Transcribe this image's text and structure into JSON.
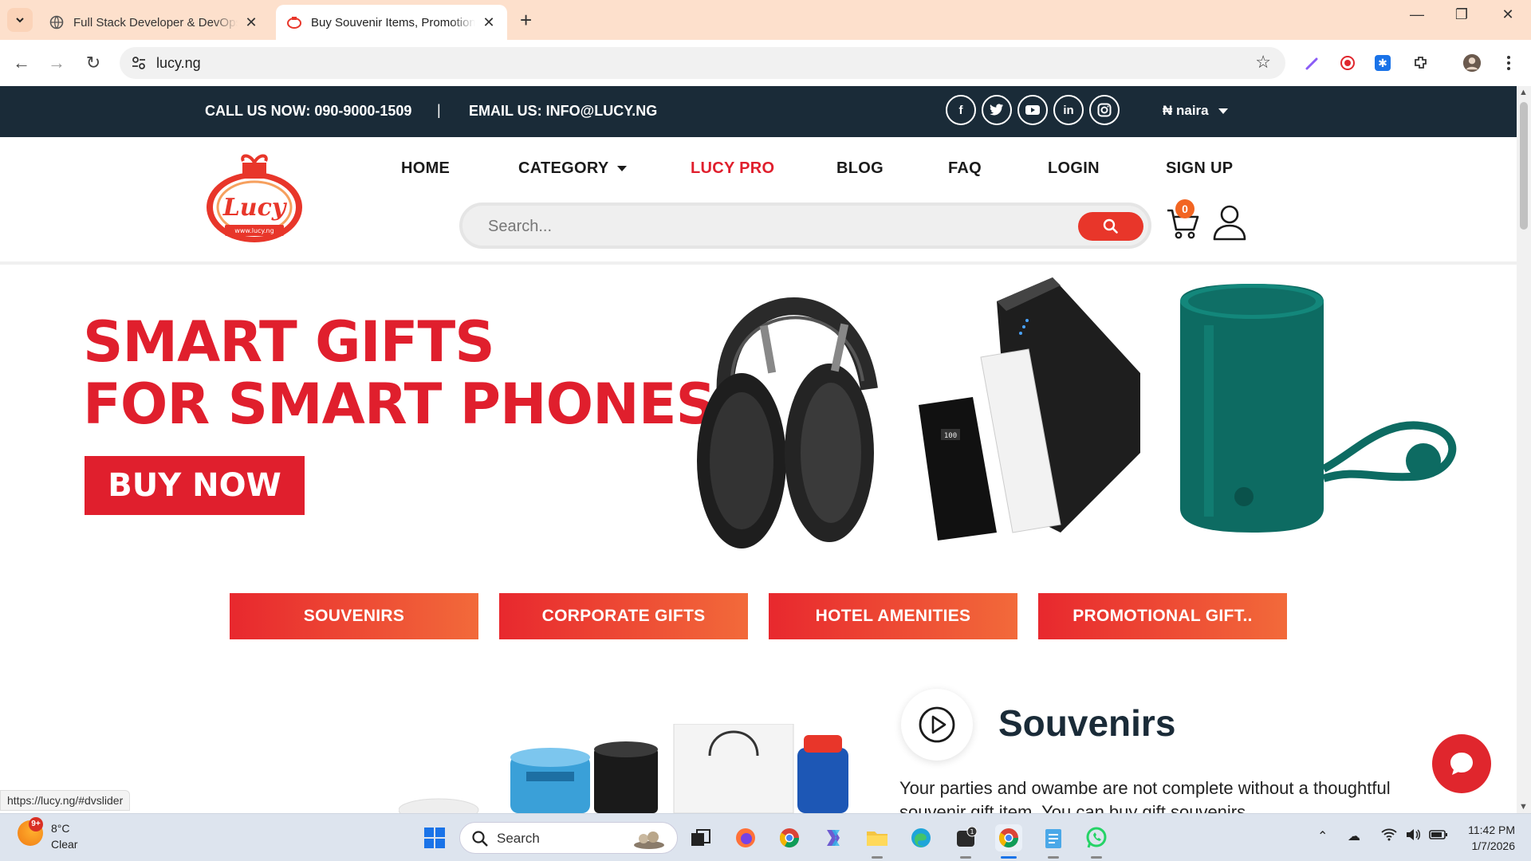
{
  "browser": {
    "tabs": [
      {
        "title": "Full Stack Developer & DevOps",
        "active": false
      },
      {
        "title": "Buy Souvenir Items, Promotional",
        "active": true
      }
    ],
    "new_tab": "+",
    "window_controls": {
      "minimize": "—",
      "maximize": "❐",
      "close": "✕"
    },
    "url": "lucy.ng"
  },
  "topbar": {
    "call": "CALL US NOW: 090-9000-1509",
    "separator": "|",
    "email": "EMAIL US: INFO@LUCY.NG",
    "social": [
      "f",
      "t",
      "▶",
      "in",
      "◎"
    ],
    "currency": "₦ naira"
  },
  "nav": {
    "items": [
      "HOME",
      "CATEGORY",
      "LUCY PRO",
      "BLOG",
      "FAQ",
      "LOGIN",
      "SIGN UP"
    ],
    "search_placeholder": "Search...",
    "cart_count": "0"
  },
  "logo": {
    "name": "Lucy",
    "site": "www.lucy.ng"
  },
  "hero": {
    "line1": "SMART GIFTS",
    "line2": "FOR SMART PHONES",
    "cta": "BUY NOW"
  },
  "categories": [
    "SOUVENIRS",
    "CORPORATE GIFTS",
    "HOTEL AMENITIES",
    "PROMOTIONAL GIFT.."
  ],
  "section": {
    "title": "Souvenirs",
    "text": "Your parties and owambe are not complete without a thoughtful souvenir gift item. You can buy gift souvenirs"
  },
  "status_url": "https://lucy.ng/#dvslider",
  "taskbar": {
    "weather_temp": "8°C",
    "weather_cond": "Clear",
    "weather_badge": "9+",
    "search": "Search",
    "time": "11:42 PM",
    "date": "1/7/2026"
  },
  "colors": {
    "brand_red": "#e01f2d",
    "topbar": "#1a2b38",
    "accent_orange": "#f26522"
  }
}
